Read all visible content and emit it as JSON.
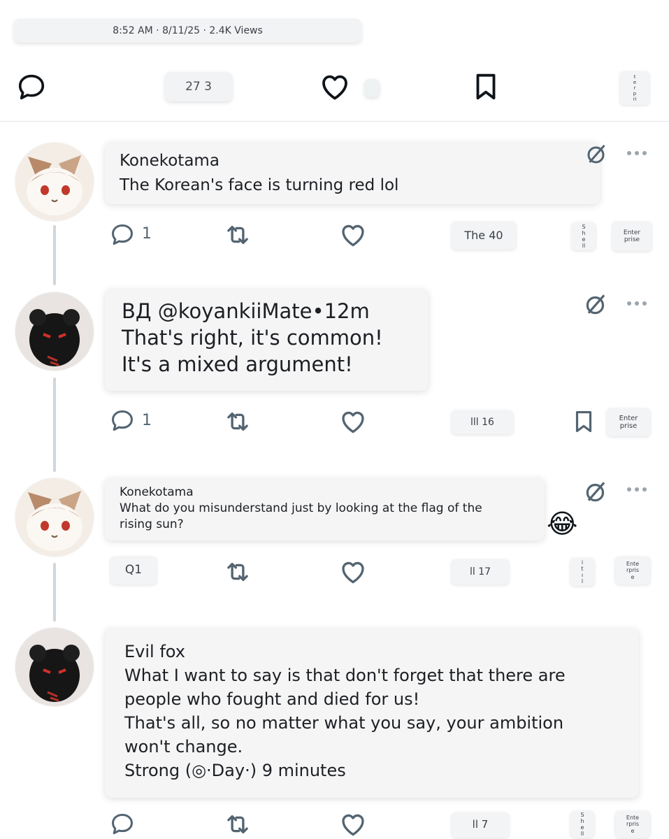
{
  "post_meta": {
    "text": "8:52 AM · 8/11/25 · 2.4K Views"
  },
  "action_bar": {
    "reposts_pill": "27 3",
    "side_pill_chars": [
      "t",
      "e",
      "r",
      "p",
      "ri"
    ]
  },
  "replies": [
    {
      "author": "Konekotama",
      "lines": [
        "The Korean's face is turning red lol"
      ],
      "reply_count": "1",
      "views_pill": "The 40",
      "share_pill_chars": [
        "S",
        "h",
        "e",
        "ll"
      ],
      "enterprise_pill": "Enter\nprise"
    },
    {
      "author": "ВД @koyankiiMate•12m",
      "lines": [
        "That's right, it's common!",
        "It's a mixed argument!"
      ],
      "reply_count": "1",
      "views_pill": "lll 16",
      "enterprise_pill": "Enter\nprise"
    },
    {
      "author": "Konekotama",
      "lines": [
        "What do you misunderstand just by looking at the flag of the",
        "rising sun?"
      ],
      "emoji": "😂",
      "reply_pill": "Q1",
      "views_pill": "ll 17",
      "share_pill_chars": [
        "i",
        "t",
        "ı",
        "l"
      ],
      "enterprise_pill": "Ente\nrpris\ne"
    },
    {
      "author": "Evil fox",
      "lines": [
        "What I want to say is that don't forget that there are",
        "people who fought and died for us!",
        "That's all, so no matter what you say, your ambition",
        "won't change.",
        "Strong (◎·Day·) 9 minutes"
      ],
      "views_pill": "ll 7",
      "share_pill_chars": [
        "S",
        "h",
        "e",
        "ll"
      ],
      "enterprise_pill": "Ente\nrpris\ne"
    }
  ],
  "colors": {
    "icon": "#536471",
    "icon_dark": "#0f1419",
    "bubble": "#f5f5f6",
    "thread_line": "#d0d6dc"
  },
  "icons": [
    "reply-icon",
    "repost-icon",
    "like-icon",
    "bookmark-icon",
    "grok-icon",
    "more-icon"
  ]
}
